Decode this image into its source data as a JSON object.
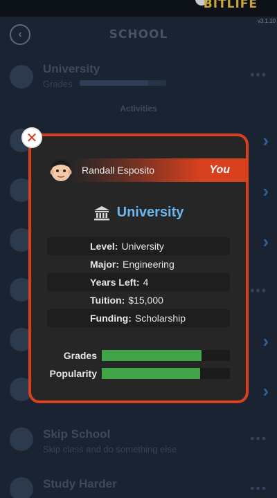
{
  "app": {
    "logo_text": "BITLIFE",
    "version": "v3.1.10"
  },
  "screen": {
    "title": "SCHOOL",
    "section_label": "Activities"
  },
  "background_rows": [
    {
      "title": "University",
      "subtitle": "Grades"
    },
    {
      "title": "Skip School",
      "subtitle": "Skip class and do something else"
    },
    {
      "title": "Study Harder",
      "subtitle": ""
    }
  ],
  "modal": {
    "person_name": "Randall Esposito",
    "you_label": "You",
    "school_name": "University",
    "info": [
      {
        "key": "Level:",
        "value": "University"
      },
      {
        "key": "Major:",
        "value": "Engineering"
      },
      {
        "key": "Years Left:",
        "value": "4"
      },
      {
        "key": "Tuition:",
        "value": "$15,000"
      },
      {
        "key": "Funding:",
        "value": "Scholarship"
      }
    ],
    "stats": [
      {
        "label": "Grades",
        "percent": 78
      },
      {
        "label": "Popularity",
        "percent": 77
      }
    ]
  },
  "colors": {
    "modal_border": "#d9411e",
    "school_name": "#6ab8ef",
    "bar_fill": "#42a449",
    "close_x": "#d9331a"
  },
  "icons": {
    "close": "close-icon",
    "school": "bank-icon",
    "back": "chevron-left-icon"
  }
}
